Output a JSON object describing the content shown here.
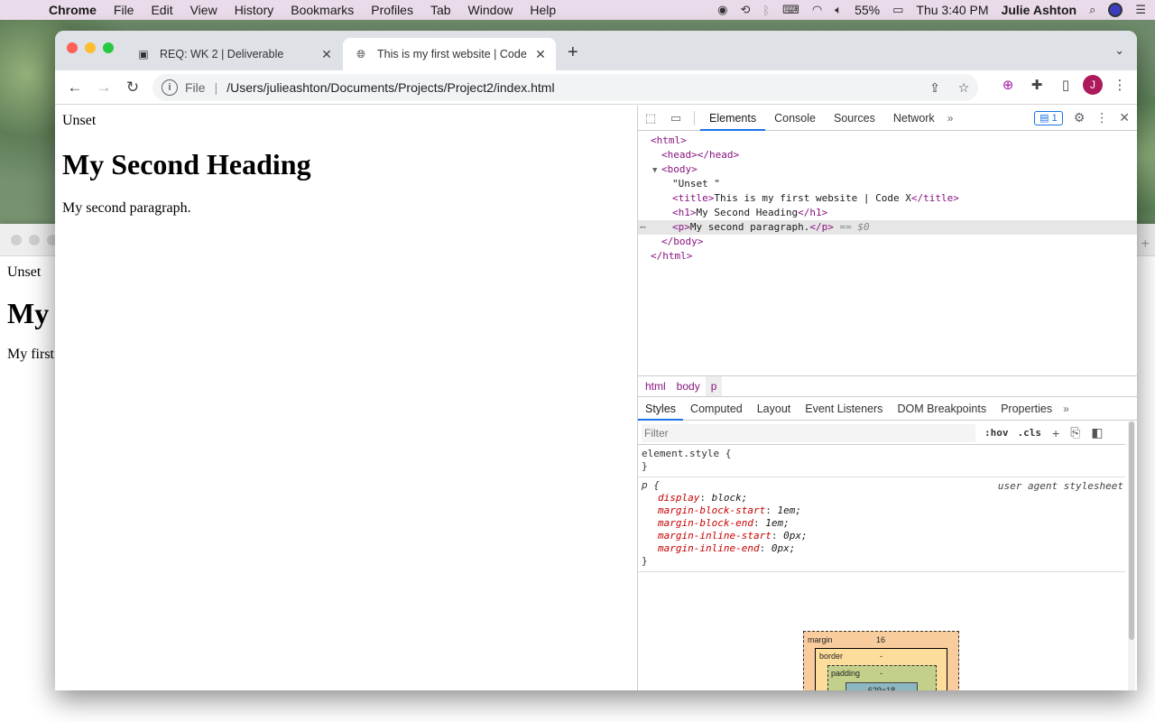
{
  "menubar": {
    "app": "Chrome",
    "items": [
      "File",
      "Edit",
      "View",
      "History",
      "Bookmarks",
      "Profiles",
      "Tab",
      "Window",
      "Help"
    ],
    "battery": "55%",
    "clock": "Thu 3:40 PM",
    "user": "Julie Ashton"
  },
  "bg_window": {
    "line1": "Unset",
    "heading": "My",
    "para": "My first"
  },
  "tabs": [
    {
      "title": "REQ: WK 2 | Deliverable"
    },
    {
      "title": "This is my first website | Code"
    }
  ],
  "toolbar": {
    "scheme": "File",
    "url": "/Users/julieashton/Documents/Projects/Project2/index.html",
    "avatar_initial": "J"
  },
  "page": {
    "text": "Unset",
    "heading": "My Second Heading",
    "paragraph": "My second paragraph."
  },
  "devtools": {
    "tabs": [
      "Elements",
      "Console",
      "Sources",
      "Network"
    ],
    "issues_count": "1",
    "dom": {
      "html_open": "<html>",
      "head": "<head></head>",
      "body_open": "<body>",
      "text_node": "\"Unset \"",
      "title_open": "<title>",
      "title_text": "This is my first website | Code X",
      "title_close": "</title>",
      "h1_open": "<h1>",
      "h1_text": "My Second Heading",
      "h1_close": "</h1>",
      "p_open": "<p>",
      "p_text": "My second paragraph.",
      "p_close": "</p>",
      "p_marker": "== $0",
      "body_close": "</body>",
      "html_close": "</html>"
    },
    "breadcrumbs": [
      "html",
      "body",
      "p"
    ],
    "subtabs": [
      "Styles",
      "Computed",
      "Layout",
      "Event Listeners",
      "DOM Breakpoints",
      "Properties"
    ],
    "filter_placeholder": "Filter",
    "hov": ":hov",
    "cls": ".cls",
    "element_style": {
      "selector": "element.style {",
      "close": "}"
    },
    "p_rule": {
      "selector": "p {",
      "origin": "user agent stylesheet",
      "props": [
        {
          "name": "display",
          "value": "block;"
        },
        {
          "name": "margin-block-start",
          "value": "1em;"
        },
        {
          "name": "margin-block-end",
          "value": "1em;"
        },
        {
          "name": "margin-inline-start",
          "value": "0px;"
        },
        {
          "name": "margin-inline-end",
          "value": "0px;"
        }
      ],
      "close": "}"
    },
    "boxmodel": {
      "margin_label": "margin",
      "margin_value": "16",
      "border_label": "border",
      "border_value": "-",
      "padding_label": "padding",
      "padding_value": "-",
      "content": "629×18",
      "dash": "-"
    }
  }
}
